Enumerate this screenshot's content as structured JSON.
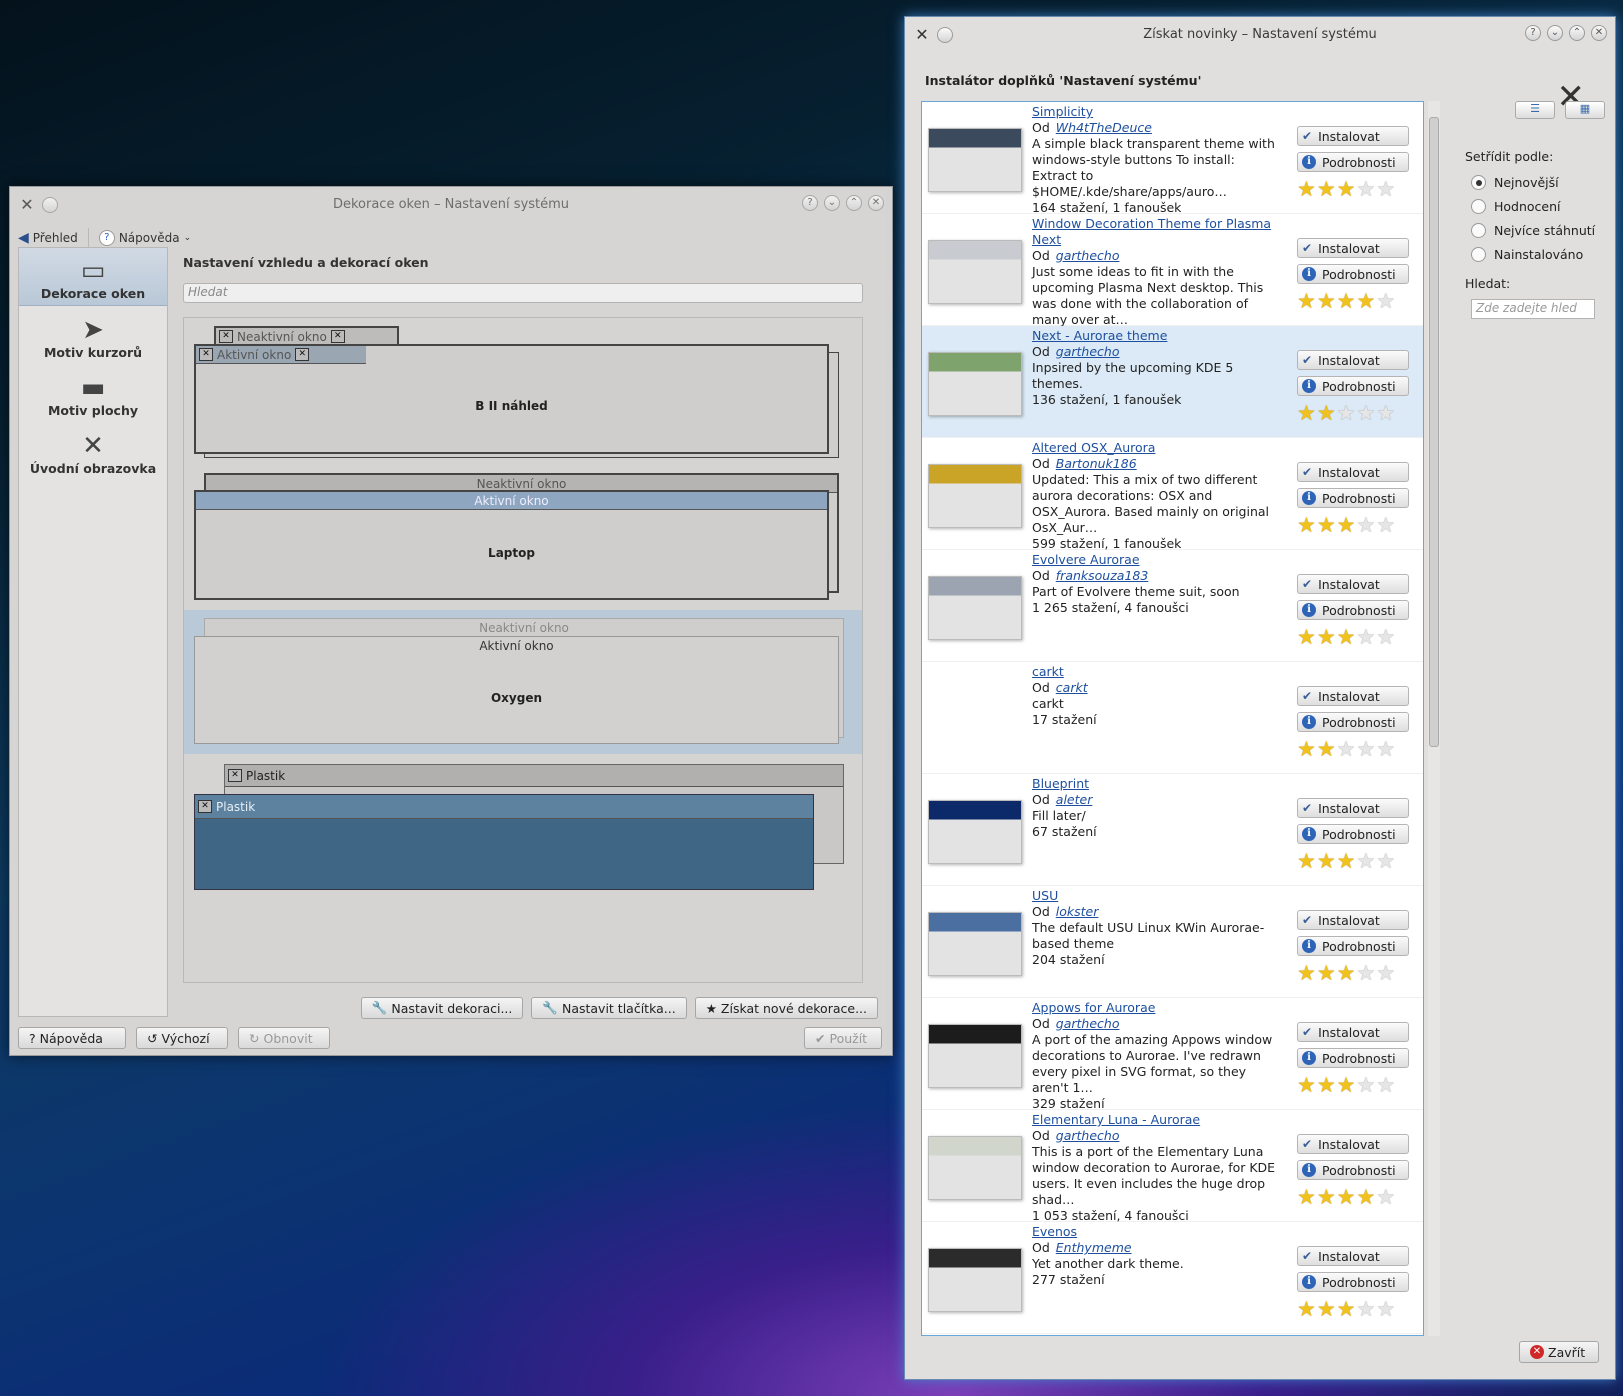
{
  "left_window": {
    "title": "Dekorace oken – Nastavení systému",
    "toolbar": {
      "overview": "Přehled",
      "help": "Nápověda"
    },
    "sidebar": [
      {
        "label": "Dekorace oken",
        "icon": "window-icon"
      },
      {
        "label": "Motiv kurzorů",
        "icon": "cursor-icon"
      },
      {
        "label": "Motiv plochy",
        "icon": "desktop-icon"
      },
      {
        "label": "Úvodní obrazovka",
        "icon": "tools-icon"
      }
    ],
    "heading": "Nastavení vzhledu a dekorací oken",
    "search_placeholder": "Hledat",
    "previews": [
      {
        "inactive_title": "Neaktivní okno",
        "active_title": "Aktivní okno",
        "name": "B II náhled"
      },
      {
        "inactive_title": "Neaktivní okno",
        "active_title": "Aktivní okno",
        "name": "Laptop"
      },
      {
        "inactive_title": "Neaktivní okno",
        "active_title": "Aktivní okno",
        "name": "Oxygen"
      },
      {
        "inactive_title": "Plastik",
        "active_title": "Plastik",
        "name": ""
      }
    ],
    "buttons": {
      "configure_decoration": "Nastavit dekoraci...",
      "configure_buttons": "Nastavit tlačítka...",
      "get_new": "Získat nové dekorace...",
      "help": "Nápověda",
      "defaults": "Výchozí",
      "reset": "Obnovit",
      "apply": "Použít"
    }
  },
  "right_window": {
    "title": "Získat novinky – Nastavení systému",
    "heading": "Instalátor doplňků 'Nastavení systému'",
    "install_label": "Instalovat",
    "details_label": "Podrobnosti",
    "by_label": "Od",
    "items": [
      {
        "name": "Simplicity",
        "author": "Wh4tTheDeuce",
        "desc": "A simple black transparent theme with windows-style buttons To install: Extract to $HOME/.kde/share/apps/auro…",
        "stats": "164 stažení, 1 fanoušek",
        "rating": 3
      },
      {
        "name": "Window Decoration Theme for Plasma Next",
        "author": "garthecho",
        "desc": "Just some ideas to fit in with the upcoming Plasma Next desktop. This was done with the collaboration of many over at…",
        "stats": "",
        "rating": 4
      },
      {
        "name": "Next - Aurorae theme",
        "author": "garthecho",
        "desc": "Inpsired by the upcoming KDE 5 themes.",
        "stats": "136 stažení, 1 fanoušek",
        "rating": 2
      },
      {
        "name": "Altered OSX_Aurora",
        "author": "Bartonuk186",
        "desc": "Updated: This a mix of two different aurora decorations: OSX and OSX_Aurora. Based mainly on original OsX_Aur…",
        "stats": "599 stažení, 1 fanoušek",
        "rating": 3
      },
      {
        "name": "Evolvere Aurorae",
        "author": "franksouza183",
        "desc": "Part of Evolvere theme suit, soon",
        "stats": "1 265 stažení, 4 fanoušci",
        "rating": 3.5
      },
      {
        "name": "carkt",
        "author": "carkt",
        "desc": "carkt",
        "stats": "17 stažení",
        "rating": 2.5
      },
      {
        "name": "Blueprint",
        "author": "aleter",
        "desc": "Fill later/",
        "stats": "67 stažení",
        "rating": 3
      },
      {
        "name": "USU",
        "author": "lokster",
        "desc": "The default USU Linux KWin Aurorae-based theme",
        "stats": "204 stažení",
        "rating": 3
      },
      {
        "name": "Appows for Aurorae",
        "author": "garthecho",
        "desc": "A port of the amazing Appows window decorations to Aurorae. I've redrawn every pixel in SVG format, so they aren't 1…",
        "stats": "329 stažení",
        "rating": 3
      },
      {
        "name": "Elementary Luna - Aurorae",
        "author": "garthecho",
        "desc": "This is a port of the Elementary Luna window decoration to Aurorae, for KDE users. It even includes the huge drop shad…",
        "stats": "1 053 stažení, 4 fanoušci",
        "rating": 4
      },
      {
        "name": "Evenos",
        "author": "Enthymeme",
        "desc": "Yet another dark theme.",
        "stats": "277 stažení",
        "rating": 3
      }
    ],
    "sort_label": "Setřídit podle:",
    "sort_options": [
      "Nejnovější",
      "Hodnocení",
      "Nejvíce stáhnutí",
      "Nainstalováno"
    ],
    "sort_selected": 0,
    "search_label": "Hledat:",
    "search_placeholder": "Zde zadejte hled",
    "close_label": "Zavřít"
  }
}
